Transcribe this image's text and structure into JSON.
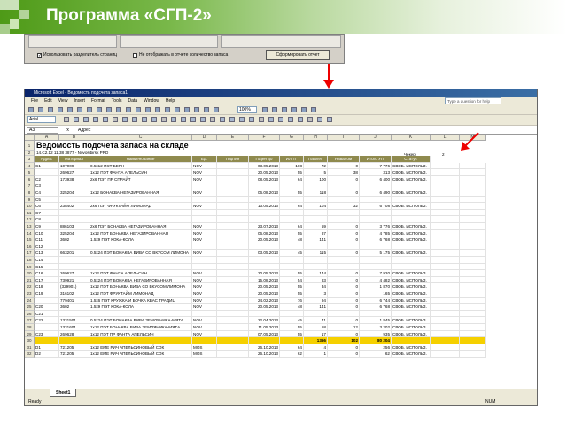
{
  "slide": {
    "title": "Программа «СГП-2»"
  },
  "dialog": {
    "option_separators": "Использовать разделитель страниц",
    "option_hide_count": "Не отображать в отчете количество запаса",
    "report_button": "Сформировать отчет"
  },
  "excel": {
    "window_title": "Microsoft Excel - Ведомость подсчета запаса1",
    "menu": [
      "File",
      "Edit",
      "View",
      "Insert",
      "Format",
      "Tools",
      "Data",
      "Window",
      "Help"
    ],
    "help_placeholder": "Type a question for help",
    "font_name": "Arial",
    "zoom": "100%",
    "name_box": "A3",
    "formula_value": "Адрес",
    "columns": [
      "A",
      "B",
      "C",
      "D",
      "E",
      "F",
      "G",
      "H",
      "I",
      "J",
      "K",
      "L",
      "M"
    ],
    "sheet_title": "Ведомость подсчета запаса на складе",
    "sheet_subtitle": "14.С2.12 11.38     3877 - Novosibirsk PRD",
    "check_label": "Чекер:",
    "check_value": "2",
    "headers": [
      "Адрес",
      "Материал",
      "Наименование",
      "Ед.",
      "Партия",
      "Годен до",
      "ИЛПТ",
      "Паллет",
      "Навалом",
      "Итого УП",
      "Статус"
    ],
    "rows": [
      [
        "4",
        "C1",
        "107009",
        "0.5x12 ПЭТ БЕРН",
        "NOV",
        "",
        "03.05.2013",
        "108",
        "72",
        "0",
        "7 776",
        "СВОБ. ИСПОЛЬЗ."
      ],
      [
        "5",
        "",
        "269627",
        "1x12 ПЭТ ФАНТА АПЕЛЬСИН",
        "NOV",
        "",
        "20.05.2013",
        "55",
        "5",
        "38",
        "313",
        "СВОБ. ИСПОЛЬЗ."
      ],
      [
        "6",
        "C2",
        "173938",
        "2x6 ПЭТ ПР СПРАЙТ",
        "NOV",
        "",
        "08.05.2013",
        "64",
        "100",
        "0",
        "6 400",
        "СВОБ. ИСПОЛЬЗ."
      ],
      [
        "7",
        "C3",
        "",
        "",
        "",
        "",
        "",
        "",
        "",
        "",
        "",
        ""
      ],
      [
        "8",
        "C4",
        "325204",
        "1x12 БОНАКВА НЕГАЗИРОВАННАЯ",
        "NOV",
        "",
        "06.08.2013",
        "55",
        "118",
        "0",
        "6 490",
        "СВОБ. ИСПОЛЬЗ."
      ],
      [
        "9",
        "C5",
        "",
        "",
        "",
        "",
        "",
        "",
        "",
        "",
        "",
        ""
      ],
      [
        "10",
        "C6",
        "238402",
        "2x6 ПЭТ ФРУКТАЙМ ЛИМОНАД",
        "NOV",
        "",
        "13.05.2013",
        "64",
        "104",
        "32",
        "6 708",
        "СВОБ. ИСПОЛЬЗ."
      ],
      [
        "11",
        "C7",
        "",
        "",
        "",
        "",
        "",
        "",
        "",
        "",
        "",
        ""
      ],
      [
        "12",
        "C8",
        "",
        "",
        "",
        "",
        "",
        "",
        "",
        "",
        "",
        ""
      ],
      [
        "13",
        "C9",
        "886103",
        "2x6 ПЭТ БОНАКВА НЕГАЗИРОВАННАЯ",
        "NOV",
        "",
        "23.07.2013",
        "64",
        "59",
        "0",
        "3 776",
        "СВОБ. ИСПОЛЬЗ."
      ],
      [
        "14",
        "C10",
        "325204",
        "1x12 ПЭТ БОНАКВА НЕГАЗИРОВАННАЯ",
        "NOV",
        "",
        "06.08.2013",
        "55",
        "87",
        "0",
        "4 785",
        "СВОБ. ИСПОЛЬЗ."
      ],
      [
        "15",
        "C11",
        "3602",
        "1.5x9 ПЭТ КОКА-КОЛА",
        "NOV",
        "",
        "20.05.2013",
        "48",
        "141",
        "0",
        "6 768",
        "СВОБ. ИСПОЛЬЗ."
      ],
      [
        "16",
        "C12",
        "",
        "",
        "",
        "",
        "",
        "",
        "",
        "",
        "",
        ""
      ],
      [
        "17",
        "C13",
        "663201",
        "0.5x24 ПЭТ БОНАКВА ВИВА СО ВКУСОМ ЛИМОНА",
        "NOV",
        "",
        "03.05.2013",
        "45",
        "115",
        "0",
        "5 175",
        "СВОБ. ИСПОЛЬЗ."
      ],
      [
        "18",
        "C14",
        "",
        "",
        "",
        "",
        "",
        "",
        "",
        "",
        "",
        ""
      ],
      [
        "19",
        "C15",
        "",
        "",
        "",
        "",
        "",
        "",
        "",
        "",
        "",
        ""
      ],
      [
        "20",
        "C16",
        "269627",
        "1x12 ПЭТ ФАНТА АПЕЛЬСИН",
        "NOV",
        "",
        "20.05.2013",
        "55",
        "144",
        "0",
        "7 920",
        "СВОБ. ИСПОЛЬЗ."
      ],
      [
        "21",
        "C17",
        "739921",
        "0.5x24 ПЭТ БОНАКВА НЕГАЗИРОВАННАЯ",
        "NOV",
        "",
        "15.08.2013",
        "54",
        "83",
        "0",
        "4 482",
        "СВОБ. ИСПОЛЬЗ."
      ],
      [
        "22",
        "C18",
        "(329901)",
        "1x12 ПЭТ БОНАКВА ВИВА СО ВКУСОМ ЛИМОНА",
        "NOV",
        "",
        "20.05.2013",
        "55",
        "34",
        "0",
        "1 870",
        "СВОБ. ИСПОЛЬЗ."
      ],
      [
        "23",
        "C19",
        "316102",
        "1x12 ПЭТ ФРУКТАЙМ ЛИМОНАД",
        "NOV",
        "",
        "20.05.2013",
        "55",
        "3",
        "0",
        "165",
        "СВОБ. ИСПОЛЬЗ."
      ],
      [
        "24",
        "",
        "779401",
        "1.5x6 ПЭТ КРУЖКА И БОЧКА КВАС ТРАДИЦ",
        "NOV",
        "",
        "24.02.2013",
        "76",
        "94",
        "0",
        "6 744",
        "СВОБ. ИСПОЛЬЗ."
      ],
      [
        "25",
        "C20",
        "3602",
        "1.5x9 ПЭТ КОКА-КОЛА",
        "NOV",
        "",
        "20.05.2013",
        "48",
        "141",
        "0",
        "6 768",
        "СВОБ. ИСПОЛЬЗ."
      ],
      [
        "26",
        "C21",
        "",
        "",
        "",
        "",
        "",
        "",
        "",
        "",
        "",
        ""
      ],
      [
        "27",
        "C22",
        "1331501",
        "0.5x24 ПЭТ БОНАКВА ВИВА ЗЕМЛЯНИКА-МЯТА",
        "NOV",
        "",
        "22.04.2013",
        "45",
        "41",
        "0",
        "1 845",
        "СВОБ. ИСПОЛЬЗ."
      ],
      [
        "28",
        "",
        "1331601",
        "1x12 ПЭТ БОНАКВА ВИВА ЗЕМЛЯНИКА-МЯТА",
        "NOV",
        "",
        "11.05.2013",
        "55",
        "58",
        "12",
        "3 202",
        "СВОБ. ИСПОЛЬЗ."
      ],
      [
        "29",
        "C23",
        "269628",
        "1x12 ПЭТ ПР ФАНТА АПЕЛЬСИН",
        "NOV",
        "",
        "07.05.2013",
        "55",
        "17",
        "0",
        "935",
        "СВОБ. ИСПОЛЬЗ."
      ],
      [
        "30",
        "",
        "",
        "",
        "",
        "",
        "",
        "",
        "1366",
        "102",
        "80 204",
        ""
      ],
      [
        "31",
        "D1",
        "721205",
        "1x12 ЕМЕ РИЧ АПЕЛЬСИНОВЫЙ СОК",
        "MOS",
        "",
        "26.10.2013",
        "64",
        "4",
        "0",
        "256",
        "СВОБ. ИСПОЛЬЗ."
      ],
      [
        "32",
        "D2",
        "721205",
        "1x12 ЕМЕ РИЧ АПЕЛЬСИНОВЫЙ СОК",
        "MOS",
        "",
        "26.10.2013",
        "62",
        "1",
        "0",
        "62",
        "СВОБ. ИСПОЛЬЗ."
      ]
    ],
    "sheet_tab": "Sheet1",
    "status_left": "Ready",
    "status_right": "NUM"
  }
}
